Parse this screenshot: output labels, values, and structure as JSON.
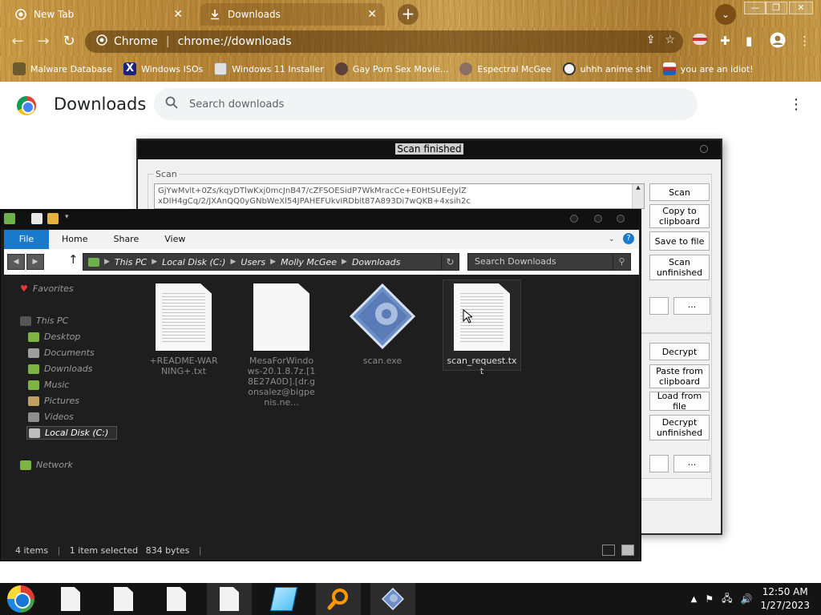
{
  "browser": {
    "tabs": [
      {
        "title": "New Tab",
        "icon": "chrome-icon"
      },
      {
        "title": "Downloads",
        "icon": "download-icon"
      }
    ],
    "new_tab_symbol": "+",
    "tab_close_symbol": "✕",
    "window_controls": [
      "—",
      "❐",
      "✕"
    ],
    "omnibox": {
      "site": "Chrome",
      "url": "chrome://downloads"
    },
    "bookmarks": [
      {
        "label": "Malware Database",
        "color": "#6b5b2e"
      },
      {
        "label": "Windows ISOs",
        "color": "#1a237e"
      },
      {
        "label": "Windows 11 Installer",
        "color": "#e0e0e0"
      },
      {
        "label": "Gay Porn Sex Movie...",
        "color": "#5d4037"
      },
      {
        "label": "Espectral McGee",
        "color": "#8d6e63"
      },
      {
        "label": "uhhh anime shit",
        "color": "#9e9e9e"
      },
      {
        "label": "you are an idiot!",
        "color": "#e8e8e8"
      }
    ]
  },
  "downloads_page": {
    "title": "Downloads",
    "search_placeholder": "Search downloads",
    "menu_symbol": "⋮"
  },
  "scan_window": {
    "title": "Scan finished",
    "group_label": "Scan",
    "text_lines": [
      "GjYwMvlt+0Zs/kqyDTlwKxj0mcJnB47/cZFSOESidP7WkMracCe+E0HtSUEeJylZ",
      "xDIH4gCq/2/JXAnQQ0yGNbWeXl54JPAHEFUkvIRDblt87A893Di7wQKB+4xsih2c"
    ],
    "buttons_top": [
      "Scan",
      "Copy to clipboard",
      "Save to file",
      "Scan unfinished"
    ],
    "buttons_bottom": [
      "Decrypt",
      "Paste from clipboard",
      "Load from file",
      "Decrypt unfinished"
    ],
    "browse_label": "..."
  },
  "explorer": {
    "ribbon_tabs": [
      "File",
      "Home",
      "Share",
      "View"
    ],
    "help_label": "?",
    "path": [
      "This PC",
      "Local Disk (C:)",
      "Users",
      "Molly McGee",
      "Downloads"
    ],
    "search_placeholder": "Search Downloads",
    "nav": {
      "favorites": "Favorites",
      "this_pc": "This PC",
      "folders": [
        "Desktop",
        "Documents",
        "Downloads",
        "Music",
        "Pictures",
        "Videos",
        "Local Disk (C:)"
      ],
      "network": "Network"
    },
    "files": [
      {
        "name": "+README-WARNING+.txt",
        "type": "text"
      },
      {
        "name": "MesaForWindows-20.1.8.7z.[18E27A0D].[dr.gonsalez@bigpenis.ne...",
        "type": "blank"
      },
      {
        "name": "scan.exe",
        "type": "exe"
      },
      {
        "name": "scan_request.txt",
        "type": "text",
        "selected": true
      }
    ],
    "status": {
      "items": "4 items",
      "selected": "1 item selected",
      "size": "834 bytes"
    }
  },
  "taskbar": {
    "time": "12:50 AM",
    "date": "1/27/2023"
  }
}
